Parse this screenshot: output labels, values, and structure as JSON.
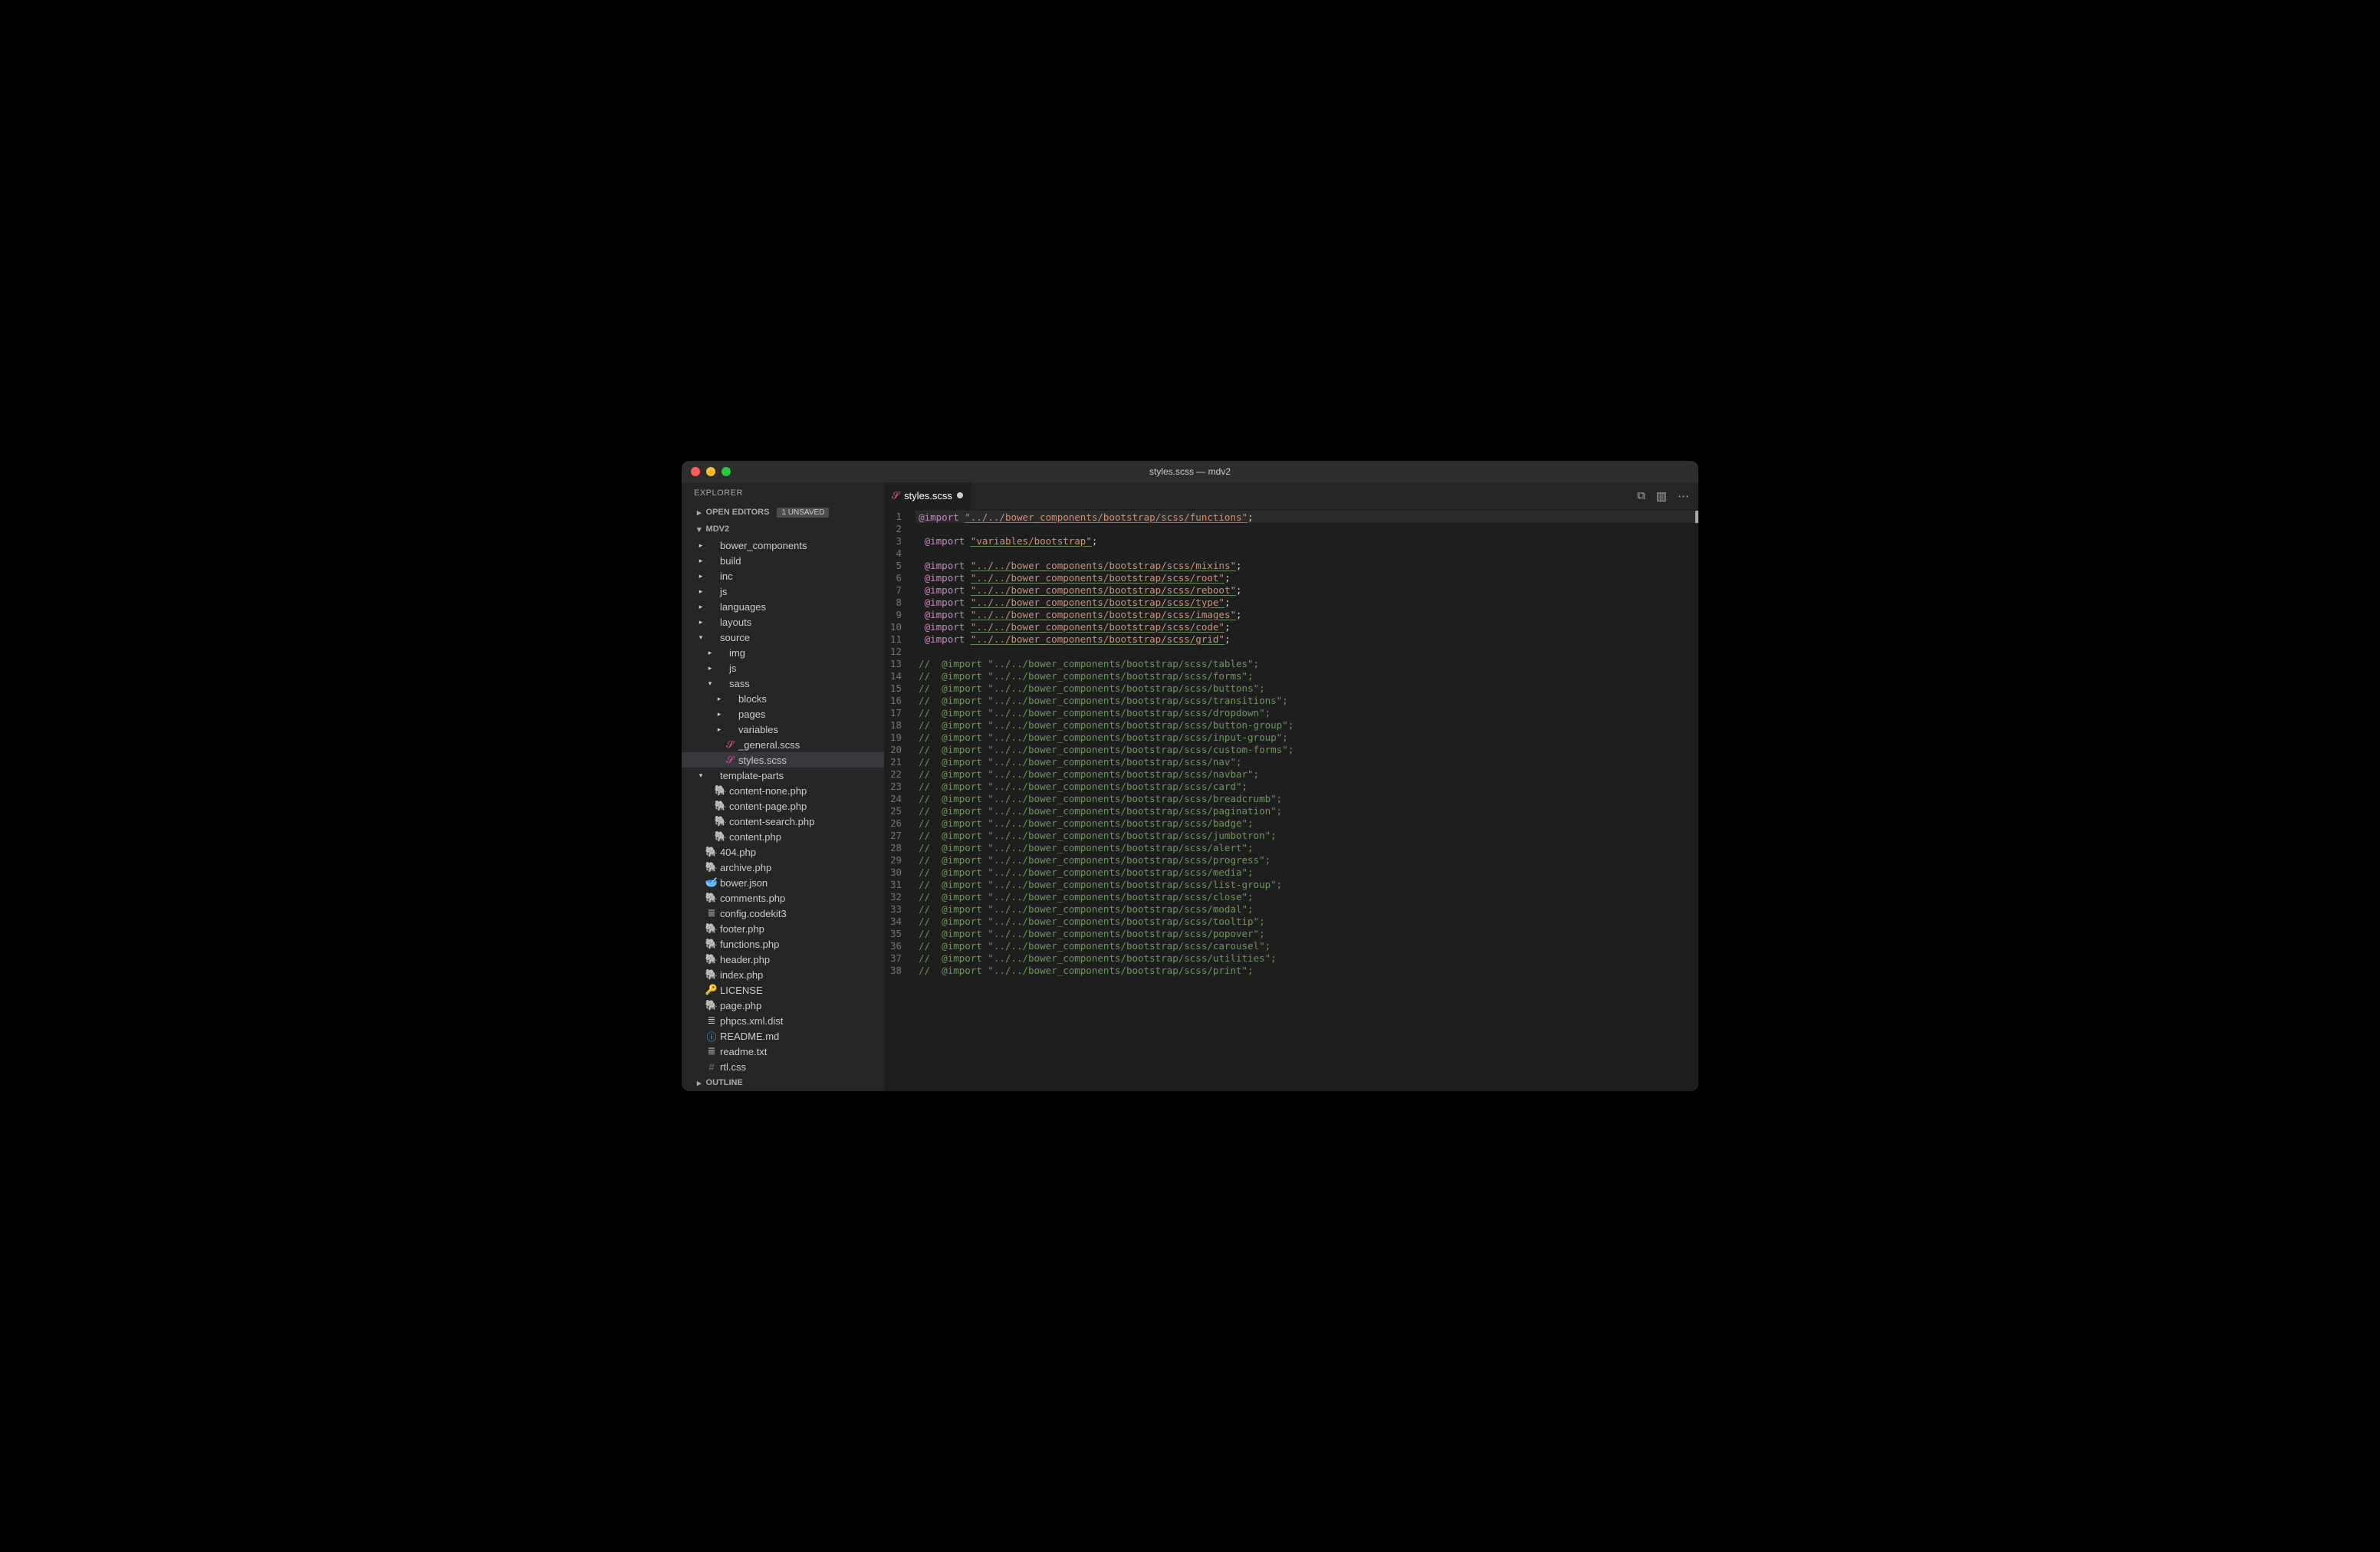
{
  "titlebar": {
    "title": "styles.scss — mdv2"
  },
  "sidebar": {
    "title": "EXPLORER",
    "openEditors": {
      "label": "OPEN EDITORS",
      "badge": "1 UNSAVED"
    },
    "root": {
      "label": "MDV2"
    },
    "outline": {
      "label": "OUTLINE"
    }
  },
  "tree": [
    {
      "depth": 1,
      "chev": "▸",
      "icon": "",
      "label": "bower_components"
    },
    {
      "depth": 1,
      "chev": "▸",
      "icon": "",
      "label": "build"
    },
    {
      "depth": 1,
      "chev": "▸",
      "icon": "",
      "label": "inc"
    },
    {
      "depth": 1,
      "chev": "▸",
      "icon": "",
      "label": "js"
    },
    {
      "depth": 1,
      "chev": "▸",
      "icon": "",
      "label": "languages"
    },
    {
      "depth": 1,
      "chev": "▸",
      "icon": "",
      "label": "layouts"
    },
    {
      "depth": 1,
      "chev": "▾",
      "icon": "",
      "label": "source"
    },
    {
      "depth": 2,
      "chev": "▸",
      "icon": "",
      "label": "img"
    },
    {
      "depth": 2,
      "chev": "▸",
      "icon": "",
      "label": "js"
    },
    {
      "depth": 2,
      "chev": "▾",
      "icon": "",
      "label": "sass"
    },
    {
      "depth": 3,
      "chev": "▸",
      "icon": "",
      "label": "blocks"
    },
    {
      "depth": 3,
      "chev": "▸",
      "icon": "",
      "label": "pages"
    },
    {
      "depth": 3,
      "chev": "▸",
      "icon": "",
      "label": "variables"
    },
    {
      "depth": 3,
      "chev": "",
      "icon": "scss",
      "iconGlyph": "𝓢",
      "label": "_general.scss"
    },
    {
      "depth": 3,
      "chev": "",
      "icon": "scss",
      "iconGlyph": "𝓢",
      "label": "styles.scss",
      "selected": true
    },
    {
      "depth": 1,
      "chev": "▾",
      "icon": "",
      "label": "template-parts"
    },
    {
      "depth": 2,
      "chev": "",
      "icon": "php",
      "iconGlyph": "🐘",
      "label": "content-none.php"
    },
    {
      "depth": 2,
      "chev": "",
      "icon": "php",
      "iconGlyph": "🐘",
      "label": "content-page.php"
    },
    {
      "depth": 2,
      "chev": "",
      "icon": "php",
      "iconGlyph": "🐘",
      "label": "content-search.php"
    },
    {
      "depth": 2,
      "chev": "",
      "icon": "php",
      "iconGlyph": "🐘",
      "label": "content.php"
    },
    {
      "depth": 1,
      "chev": "",
      "icon": "php",
      "iconGlyph": "🐘",
      "label": "404.php"
    },
    {
      "depth": 1,
      "chev": "",
      "icon": "php",
      "iconGlyph": "🐘",
      "label": "archive.php"
    },
    {
      "depth": 1,
      "chev": "",
      "icon": "json",
      "iconGlyph": "🥣",
      "label": "bower.json"
    },
    {
      "depth": 1,
      "chev": "",
      "icon": "php",
      "iconGlyph": "🐘",
      "label": "comments.php"
    },
    {
      "depth": 1,
      "chev": "",
      "icon": "txt",
      "iconGlyph": "≣",
      "label": "config.codekit3"
    },
    {
      "depth": 1,
      "chev": "",
      "icon": "php",
      "iconGlyph": "🐘",
      "label": "footer.php"
    },
    {
      "depth": 1,
      "chev": "",
      "icon": "php",
      "iconGlyph": "🐘",
      "label": "functions.php"
    },
    {
      "depth": 1,
      "chev": "",
      "icon": "php",
      "iconGlyph": "🐘",
      "label": "header.php"
    },
    {
      "depth": 1,
      "chev": "",
      "icon": "php",
      "iconGlyph": "🐘",
      "label": "index.php"
    },
    {
      "depth": 1,
      "chev": "",
      "icon": "json",
      "iconGlyph": "🔑",
      "label": "LICENSE"
    },
    {
      "depth": 1,
      "chev": "",
      "icon": "php",
      "iconGlyph": "🐘",
      "label": "page.php"
    },
    {
      "depth": 1,
      "chev": "",
      "icon": "txt",
      "iconGlyph": "≣",
      "label": "phpcs.xml.dist"
    },
    {
      "depth": 1,
      "chev": "",
      "icon": "info",
      "iconGlyph": "ⓘ",
      "label": "README.md"
    },
    {
      "depth": 1,
      "chev": "",
      "icon": "txt",
      "iconGlyph": "≣",
      "label": "readme.txt"
    },
    {
      "depth": 1,
      "chev": "",
      "icon": "hash",
      "iconGlyph": "#",
      "label": "rtl.css"
    }
  ],
  "tab": {
    "iconGlyph": "𝓢",
    "label": "styles.scss"
  },
  "code": [
    {
      "n": 1,
      "type": "import",
      "hl": true,
      "path": "../../bower_components/bootstrap/scss/functions"
    },
    {
      "n": 2,
      "type": "blank"
    },
    {
      "n": 3,
      "type": "import-indent",
      "path": "variables/bootstrap"
    },
    {
      "n": 4,
      "type": "blank"
    },
    {
      "n": 5,
      "type": "import-indent",
      "path": "../../bower_components/bootstrap/scss/mixins"
    },
    {
      "n": 6,
      "type": "import-indent",
      "path": "../../bower_components/bootstrap/scss/root"
    },
    {
      "n": 7,
      "type": "import-indent",
      "path": "../../bower_components/bootstrap/scss/reboot"
    },
    {
      "n": 8,
      "type": "import-indent",
      "path": "../../bower_components/bootstrap/scss/type"
    },
    {
      "n": 9,
      "type": "import-indent",
      "path": "../../bower_components/bootstrap/scss/images"
    },
    {
      "n": 10,
      "type": "import-indent",
      "path": "../../bower_components/bootstrap/scss/code"
    },
    {
      "n": 11,
      "type": "import-indent",
      "path": "../../bower_components/bootstrap/scss/grid"
    },
    {
      "n": 12,
      "type": "blank"
    },
    {
      "n": 13,
      "type": "comment",
      "text": "//  @import \"../../bower_components/bootstrap/scss/tables\";"
    },
    {
      "n": 14,
      "type": "comment",
      "text": "//  @import \"../../bower_components/bootstrap/scss/forms\";"
    },
    {
      "n": 15,
      "type": "comment",
      "text": "//  @import \"../../bower_components/bootstrap/scss/buttons\";"
    },
    {
      "n": 16,
      "type": "comment",
      "text": "//  @import \"../../bower_components/bootstrap/scss/transitions\";"
    },
    {
      "n": 17,
      "type": "comment",
      "text": "//  @import \"../../bower_components/bootstrap/scss/dropdown\";"
    },
    {
      "n": 18,
      "type": "comment",
      "text": "//  @import \"../../bower_components/bootstrap/scss/button-group\";"
    },
    {
      "n": 19,
      "type": "comment",
      "text": "//  @import \"../../bower_components/bootstrap/scss/input-group\";"
    },
    {
      "n": 20,
      "type": "comment",
      "text": "//  @import \"../../bower_components/bootstrap/scss/custom-forms\";"
    },
    {
      "n": 21,
      "type": "comment",
      "text": "//  @import \"../../bower_components/bootstrap/scss/nav\";"
    },
    {
      "n": 22,
      "type": "comment",
      "text": "//  @import \"../../bower_components/bootstrap/scss/navbar\";"
    },
    {
      "n": 23,
      "type": "comment",
      "text": "//  @import \"../../bower_components/bootstrap/scss/card\";"
    },
    {
      "n": 24,
      "type": "comment",
      "text": "//  @import \"../../bower_components/bootstrap/scss/breadcrumb\";"
    },
    {
      "n": 25,
      "type": "comment",
      "text": "//  @import \"../../bower_components/bootstrap/scss/pagination\";"
    },
    {
      "n": 26,
      "type": "comment",
      "text": "//  @import \"../../bower_components/bootstrap/scss/badge\";"
    },
    {
      "n": 27,
      "type": "comment",
      "text": "//  @import \"../../bower_components/bootstrap/scss/jumbotron\";"
    },
    {
      "n": 28,
      "type": "comment",
      "text": "//  @import \"../../bower_components/bootstrap/scss/alert\";"
    },
    {
      "n": 29,
      "type": "comment",
      "text": "//  @import \"../../bower_components/bootstrap/scss/progress\";"
    },
    {
      "n": 30,
      "type": "comment",
      "text": "//  @import \"../../bower_components/bootstrap/scss/media\";"
    },
    {
      "n": 31,
      "type": "comment",
      "text": "//  @import \"../../bower_components/bootstrap/scss/list-group\";"
    },
    {
      "n": 32,
      "type": "comment",
      "text": "//  @import \"../../bower_components/bootstrap/scss/close\";"
    },
    {
      "n": 33,
      "type": "comment",
      "text": "//  @import \"../../bower_components/bootstrap/scss/modal\";"
    },
    {
      "n": 34,
      "type": "comment",
      "text": "//  @import \"../../bower_components/bootstrap/scss/tooltip\";"
    },
    {
      "n": 35,
      "type": "comment",
      "text": "//  @import \"../../bower_components/bootstrap/scss/popover\";"
    },
    {
      "n": 36,
      "type": "comment",
      "text": "//  @import \"../../bower_components/bootstrap/scss/carousel\";"
    },
    {
      "n": 37,
      "type": "comment",
      "text": "//  @import \"../../bower_components/bootstrap/scss/utilities\";"
    },
    {
      "n": 38,
      "type": "comment",
      "text": "//  @import \"../../bower_components/bootstrap/scss/print\";"
    }
  ]
}
